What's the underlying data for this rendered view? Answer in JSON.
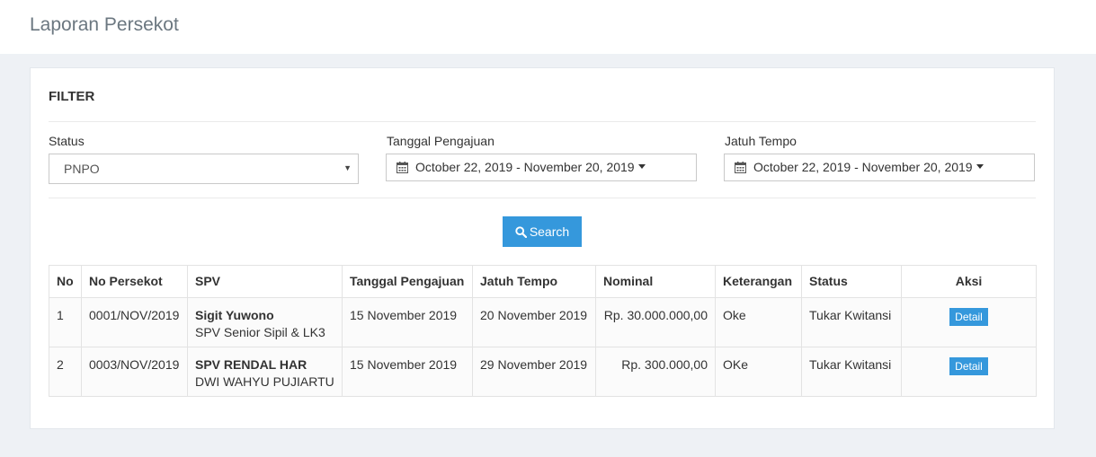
{
  "page": {
    "title": "Laporan Persekot"
  },
  "filter": {
    "title": "FILTER",
    "status": {
      "label": "Status",
      "value": "PNPO"
    },
    "tanggal_pengajuan": {
      "label": "Tanggal Pengajuan",
      "value": "October 22, 2019 - November 20, 2019"
    },
    "jatuh_tempo": {
      "label": "Jatuh Tempo",
      "value": "October 22, 2019 - November 20, 2019"
    },
    "search_label": "Search"
  },
  "table": {
    "headers": [
      "No",
      "No Persekot",
      "SPV",
      "Tanggal Pengajuan",
      "Jatuh Tempo",
      "Nominal",
      "Keterangan",
      "Status",
      "Aksi"
    ],
    "rows": [
      {
        "no": "1",
        "no_persekot": "0001/NOV/2019",
        "spv_name": "Sigit Yuwono",
        "spv_role": "SPV Senior Sipil & LK3",
        "tanggal_pengajuan": "15 November 2019",
        "jatuh_tempo": "20 November 2019",
        "nominal": "Rp. 30.000.000,00",
        "keterangan": "Oke",
        "status": "Tukar Kwitansi",
        "aksi": "Detail"
      },
      {
        "no": "2",
        "no_persekot": "0003/NOV/2019",
        "spv_name": "SPV RENDAL HAR",
        "spv_role": "DWI WAHYU PUJIARTU",
        "tanggal_pengajuan": "15 November 2019",
        "jatuh_tempo": "29 November 2019",
        "nominal": "Rp. 300.000,00",
        "keterangan": "OKe",
        "status": "Tukar Kwitansi",
        "aksi": "Detail"
      }
    ]
  },
  "colors": {
    "accent": "#3598dc",
    "background": "#eef1f5"
  },
  "icons": {
    "calendar": "calendar-icon",
    "search": "search-icon",
    "caret": "caret-down-icon"
  }
}
